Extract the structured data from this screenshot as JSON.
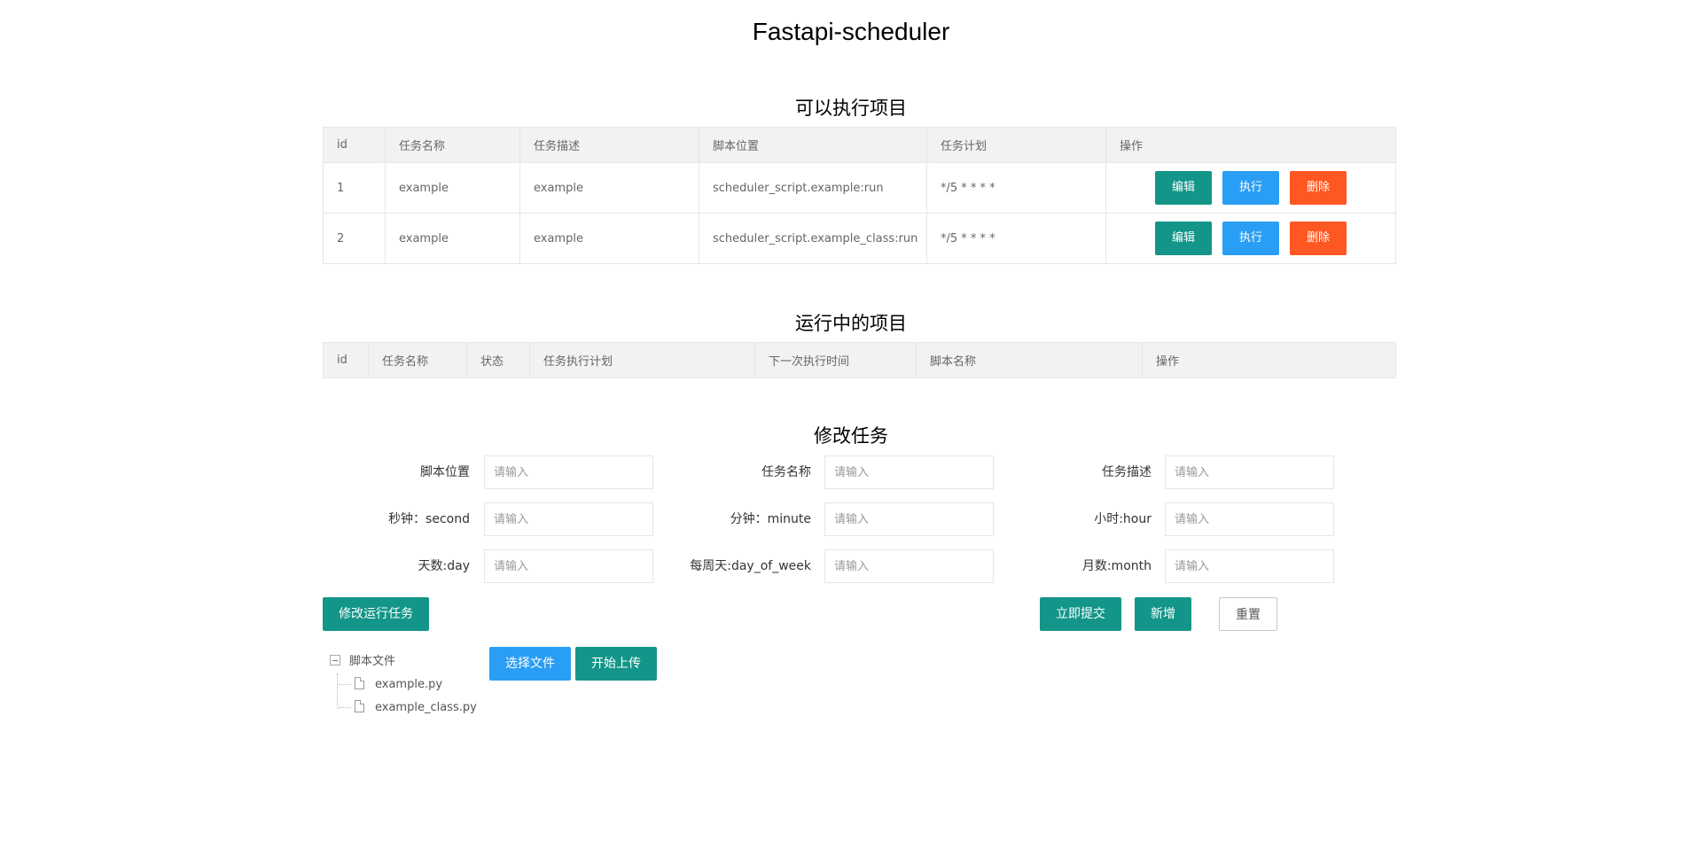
{
  "app": {
    "title": "Fastapi-scheduler"
  },
  "available": {
    "title": "可以执行项目",
    "columns": [
      "id",
      "任务名称",
      "任务描述",
      "脚本位置",
      "任务计划",
      "操作"
    ],
    "rows": [
      {
        "id": "1",
        "name": "example",
        "desc": "example",
        "script": "scheduler_script.example:run",
        "plan": "*/5 * * * * "
      },
      {
        "id": "2",
        "name": "example",
        "desc": "example",
        "script": "scheduler_script.example_class:run",
        "plan": "*/5 * * * * "
      }
    ],
    "actions": {
      "edit": "编辑",
      "run": "执行",
      "delete": "删除"
    }
  },
  "running": {
    "title": "运行中的项目",
    "columns": [
      "id",
      "任务名称",
      "状态",
      "任务执行计划",
      "下一次执行时间",
      "脚本名称",
      "操作"
    ]
  },
  "form": {
    "title": "修改任务",
    "placeholder": "请输入",
    "fields": {
      "script_path": "脚本位置",
      "task_name": "任务名称",
      "task_desc": "任务描述",
      "second": "秒钟：second",
      "minute": "分钟：minute",
      "hour": "小时:hour",
      "day": "天数:day",
      "day_of_week": "每周天:day_of_week",
      "month": "月数:month"
    },
    "buttons": {
      "modify_running": "修改运行任务",
      "submit": "立即提交",
      "add": "新增",
      "reset": "重置"
    }
  },
  "upload": {
    "choose_file": "选择文件",
    "start_upload": "开始上传"
  },
  "tree": {
    "root": "脚本文件",
    "files": [
      "example.py",
      "example_class.py"
    ]
  },
  "colors": {
    "green": "#139689",
    "blue": "#2a9ef4",
    "red": "#ff5722"
  }
}
